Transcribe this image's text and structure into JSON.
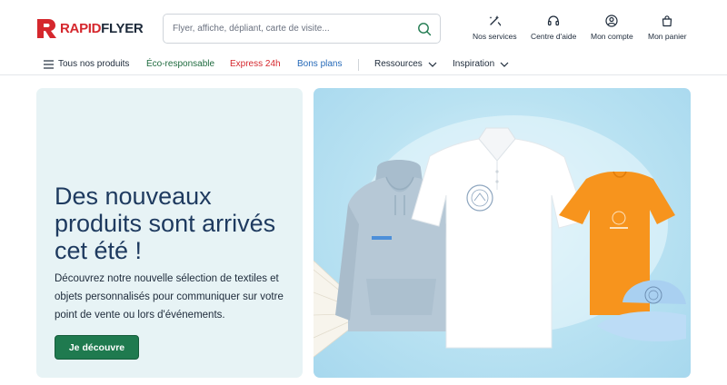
{
  "brand": {
    "part1": "RAPID",
    "part2": "FLYER",
    "color_red": "#d5272d",
    "color_dark": "#1d2a3a"
  },
  "search": {
    "placeholder": "Flyer, affiche, dépliant, carte de visite..."
  },
  "header_nav": [
    {
      "label": "Nos services",
      "icon": "sparkle-tools-icon"
    },
    {
      "label": "Centre d'aide",
      "icon": "headset-icon"
    },
    {
      "label": "Mon compte",
      "icon": "user-icon"
    },
    {
      "label": "Mon panier",
      "icon": "bag-icon"
    }
  ],
  "categories": [
    {
      "label": "Tous nos produits",
      "color": "#1d2a3a"
    },
    {
      "label": "Éco-responsable",
      "color": "#1f6b3f"
    },
    {
      "label": "Express 24h",
      "color": "#d5272d"
    },
    {
      "label": "Bons plans",
      "color": "#2569b8"
    },
    {
      "label": "Ressources",
      "color": "#1d2a3a"
    },
    {
      "label": "Inspiration",
      "color": "#1d2a3a"
    }
  ],
  "hero": {
    "title": "Des nouveaux produits sont arrivés cet été !",
    "description": "Découvrez notre nouvelle sélection de textiles et objets personnalisés pour communiquer sur votre point de vente ou lors d'événements.",
    "cta": "Je découvre",
    "cta_color": "#1f7a4f",
    "image_alt": "Textiles personnalisés"
  }
}
